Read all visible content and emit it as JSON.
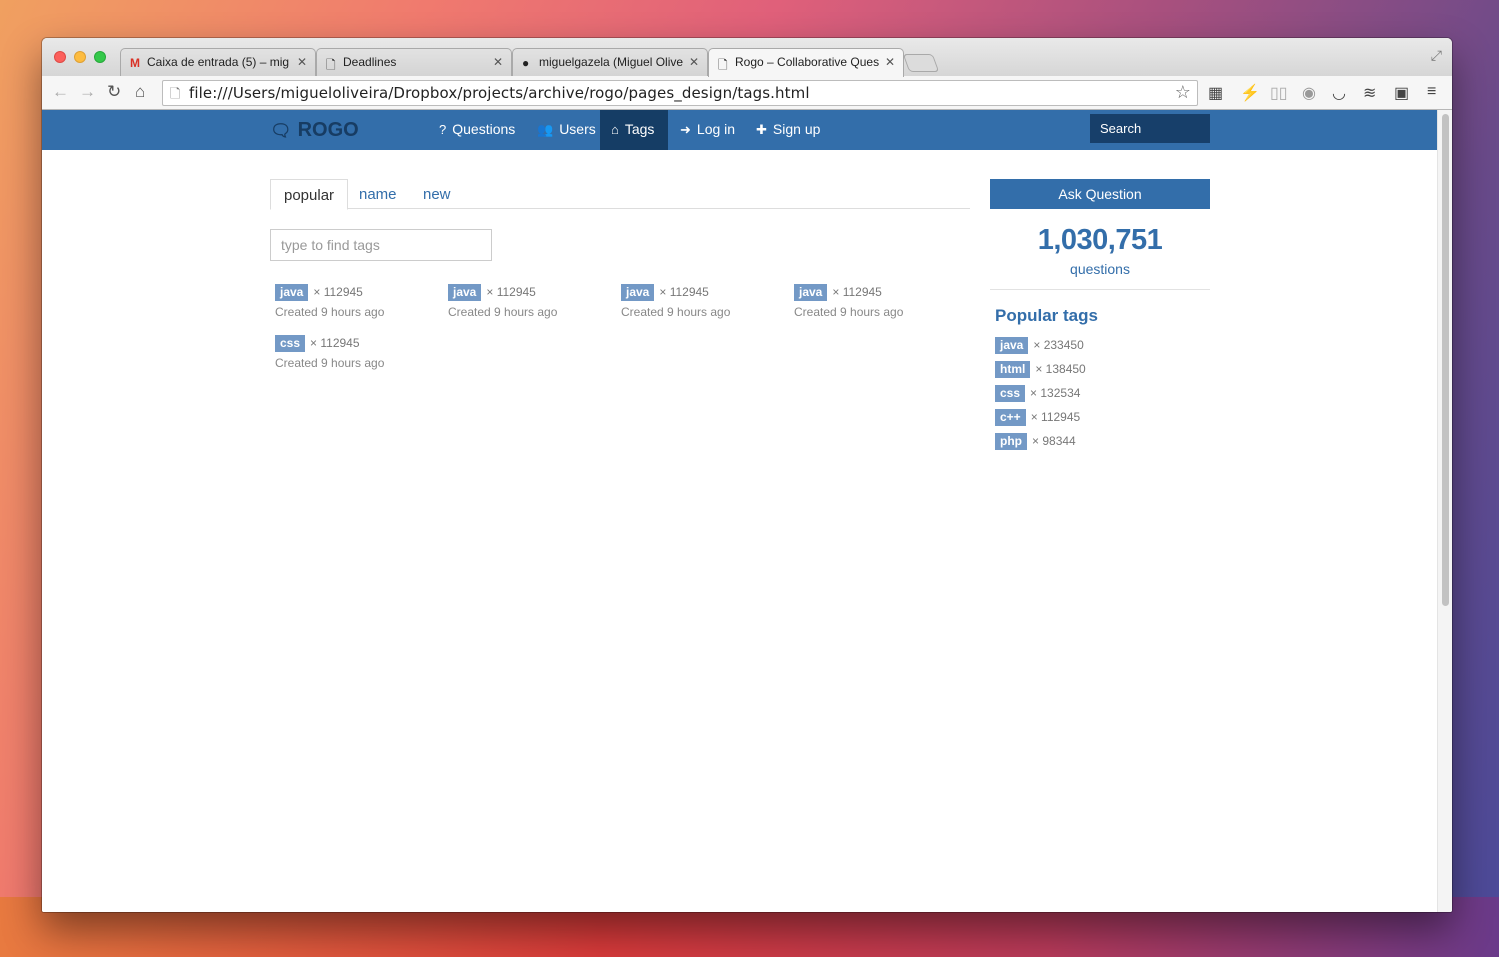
{
  "browser": {
    "tabs": [
      {
        "label": "Caixa de entrada (5) – mig",
        "icon": "gmail-icon"
      },
      {
        "label": "Deadlines",
        "icon": "page-icon"
      },
      {
        "label": "miguelgazela (Miguel Olive",
        "icon": "github-icon"
      },
      {
        "label": "Rogo – Collaborative Ques",
        "icon": "page-icon"
      }
    ],
    "url": "file:///Users/migueloliveira/Dropbox/projects/archive/rogo/pages_design/tags.html"
  },
  "site": {
    "brand": "ROGO",
    "nav": [
      {
        "label": "Questions",
        "icon": "question-circle-icon"
      },
      {
        "label": "Users",
        "icon": "users-icon"
      },
      {
        "label": "Tags",
        "icon": "tags-icon"
      },
      {
        "label": "Log in",
        "icon": "sign-in-icon"
      },
      {
        "label": "Sign up",
        "icon": "plus-icon"
      }
    ],
    "search_placeholder": "Search"
  },
  "content": {
    "tabs": [
      "popular",
      "name",
      "new"
    ],
    "filter_placeholder": "type to find tags",
    "tags": [
      {
        "name": "java",
        "count": "× 112945",
        "created": "Created 9 hours ago"
      },
      {
        "name": "java",
        "count": "× 112945",
        "created": "Created 9 hours ago"
      },
      {
        "name": "java",
        "count": "× 112945",
        "created": "Created 9 hours ago"
      },
      {
        "name": "java",
        "count": "× 112945",
        "created": "Created 9 hours ago"
      },
      {
        "name": "css",
        "count": "× 112945",
        "created": "Created 9 hours ago"
      }
    ]
  },
  "sidebar": {
    "ask_label": "Ask Question",
    "question_count": "1,030,751",
    "question_label": "questions",
    "popular_title": "Popular tags",
    "popular": [
      {
        "name": "java",
        "count": "× 233450"
      },
      {
        "name": "html",
        "count": "× 138450"
      },
      {
        "name": "css",
        "count": "× 132534"
      },
      {
        "name": "c++",
        "count": "× 112945"
      },
      {
        "name": "php",
        "count": "× 98344"
      }
    ]
  },
  "colors": {
    "brand_blue": "#336eaa",
    "active_nav": "#153d65",
    "tag_chip": "#7399c6"
  }
}
